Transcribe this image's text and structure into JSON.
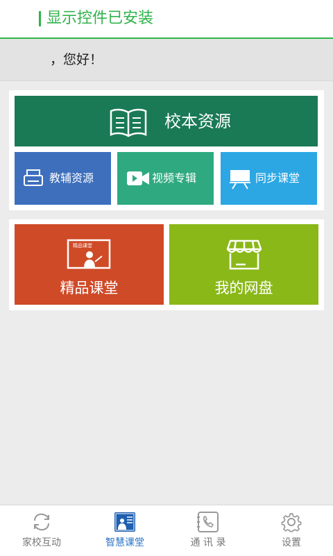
{
  "header": {
    "title": "显示控件已安装"
  },
  "greeting": {
    "text": "，您好！"
  },
  "tiles": {
    "school_resources": "校本资源",
    "tutoring_resources": "教辅资源",
    "video_album": "视频专辑",
    "sync_classroom": "同步课堂",
    "quality_classroom": "精品课堂",
    "quality_classroom_icon_text": "精品课堂",
    "my_netdisk": "我的网盘"
  },
  "tabbar": {
    "items": [
      {
        "label": "家校互动",
        "icon": "sync-icon",
        "active": false
      },
      {
        "label": "智慧课堂",
        "icon": "smart-classroom-icon",
        "active": true
      },
      {
        "label": "通 讯 录",
        "icon": "phone-book-icon",
        "active": false
      },
      {
        "label": "设置",
        "icon": "gear-icon",
        "active": false
      }
    ]
  },
  "colors": {
    "accent": "#2fb34a",
    "school_tile": "#1a7a55",
    "tutoring_tile": "#3d6fbd",
    "video_tile": "#2faa80",
    "sync_tile": "#2ca7e4",
    "quality_tile": "#cf4a27",
    "netdisk_tile": "#8ab818",
    "tab_active": "#2a74c8"
  }
}
